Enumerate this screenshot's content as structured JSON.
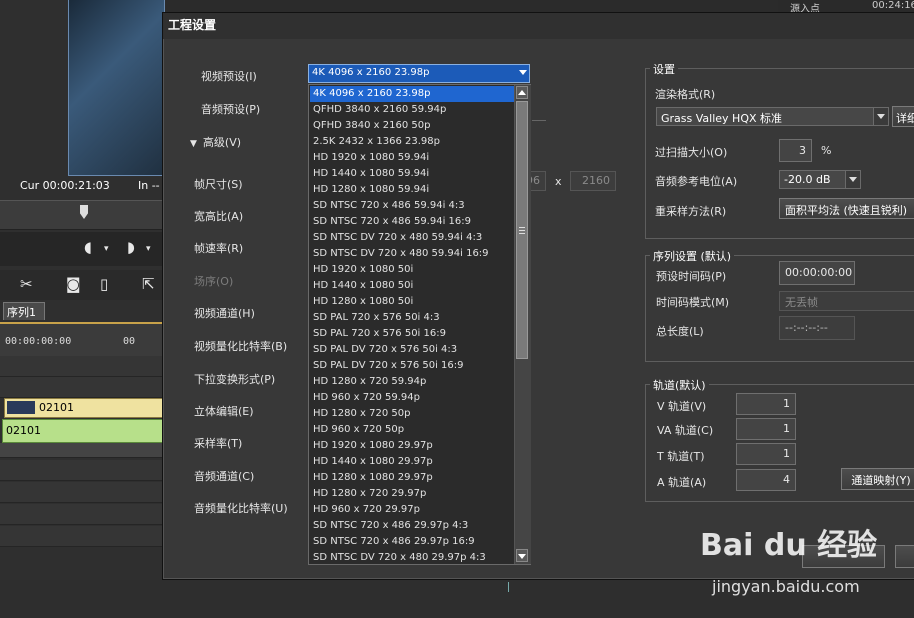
{
  "background": {
    "cur_label": "Cur 00:00:21:03",
    "in_label": "In --",
    "sequence_tab": "序列1",
    "ruler_tc_start": "00:00:00:00",
    "ruler_tc_next": "00",
    "clip_video_name": "02101",
    "clip_audio_name": "02101",
    "right_strip_col1": "源入点",
    "right_strip_col2": "00:24:16"
  },
  "dialog": {
    "title": "工程设置",
    "left_labels": {
      "video_preset": "视频预设(I)",
      "audio_preset": "音频预设(P)",
      "advanced": "高级(V)",
      "frame_size": "帧尺寸(S)",
      "aspect": "宽高比(A)",
      "frame_rate": "帧速率(R)",
      "field_order": "场序(O)",
      "video_channel": "视频通道(H)",
      "video_quant": "视频量化比特率(B)",
      "pulldown": "下拉变换形式(P)",
      "stereo_edit": "立体编辑(E)",
      "sample_rate": "采样率(T)",
      "audio_channel": "音频通道(C)",
      "audio_quant": "音频量化比特率(U)"
    },
    "frame_size": {
      "width": "96",
      "x": "x",
      "height": "2160"
    },
    "video_preset_selected": "4K 4096 x 2160 23.98p",
    "preset_options": [
      "4K 4096 x 2160 23.98p",
      "QFHD 3840 x 2160 59.94p",
      "QFHD 3840 x 2160 50p",
      "2.5K 2432 x 1366 23.98p",
      "HD 1920 x 1080 59.94i",
      "HD 1440 x 1080 59.94i",
      "HD 1280 x 1080 59.94i",
      "SD NTSC 720 x 486 59.94i 4:3",
      "SD NTSC 720 x 486 59.94i 16:9",
      "SD NTSC DV 720 x 480 59.94i 4:3",
      "SD NTSC DV 720 x 480 59.94i 16:9",
      "HD 1920 x 1080 50i",
      "HD 1440 x 1080 50i",
      "HD 1280 x 1080 50i",
      "SD PAL 720 x 576 50i 4:3",
      "SD PAL 720 x 576 50i 16:9",
      "SD PAL DV 720 x 576 50i 4:3",
      "SD PAL DV 720 x 576 50i 16:9",
      "HD 1280 x 720 59.94p",
      "HD 960 x 720 59.94p",
      "HD 1280 x 720 50p",
      "HD 960 x 720 50p",
      "HD 1920 x 1080 29.97p",
      "HD 1440 x 1080 29.97p",
      "HD 1280 x 1080 29.97p",
      "HD 1280 x 720 29.97p",
      "HD 960 x 720 29.97p",
      "SD NTSC 720 x 486 29.97p 4:3",
      "SD NTSC 720 x 486 29.97p 16:9",
      "SD NTSC DV 720 x 480 29.97p 4:3"
    ],
    "settings": {
      "group_title": "设置",
      "render_format_label": "渲染格式(R)",
      "render_format_value": "Grass Valley HQX 标准",
      "detail_button": "详细",
      "overscan_label": "过扫描大小(O)",
      "overscan_value": "3",
      "overscan_unit": "%",
      "audio_ref_label": "音频参考电位(A)",
      "audio_ref_value": "-20.0 dB",
      "resample_label": "重采样方法(R)",
      "resample_value": "面积平均法 (快速且锐利)"
    },
    "sequence": {
      "group_title": "序列设置 (默认)",
      "preset_tc_label": "预设时间码(P)",
      "preset_tc_value": "00:00:00:00",
      "tc_mode_label": "时间码模式(M)",
      "tc_mode_value": "无丢帧",
      "total_length_label": "总长度(L)",
      "total_length_value": "--:--:--:--"
    },
    "tracks": {
      "group_title": "轨道(默认)",
      "v_label": "V 轨道(V)",
      "v_value": "1",
      "va_label": "VA 轨道(C)",
      "va_value": "1",
      "t_label": "T 轨道(T)",
      "t_value": "1",
      "a_label": "A 轨道(A)",
      "a_value": "4",
      "channel_map_button": "通道映射(Y)"
    }
  },
  "watermark": {
    "text": "Bai du 经验",
    "url": "jingyan.baidu.com"
  }
}
